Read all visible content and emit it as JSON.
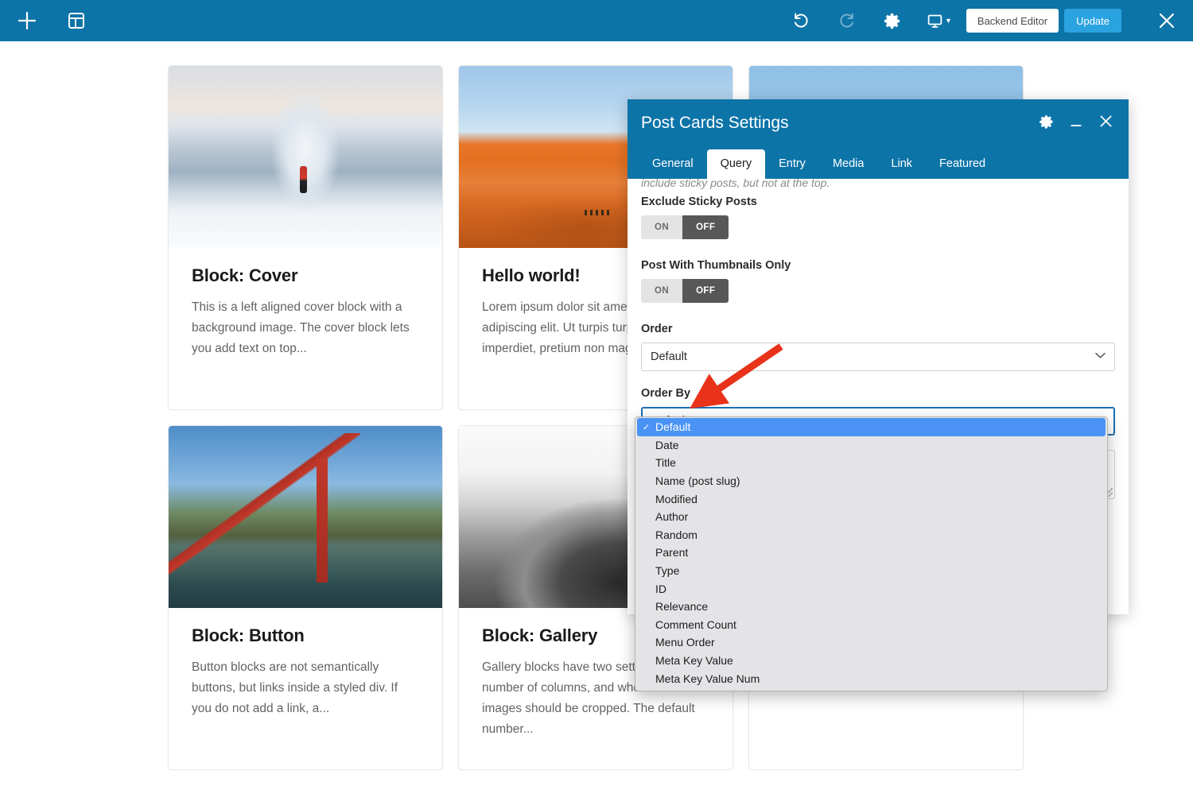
{
  "toolbar": {
    "add_icon": "plus-icon",
    "templates_icon": "layout-template-icon",
    "undo_icon": "undo-icon",
    "redo_icon": "redo-icon",
    "settings_icon": "gear-icon",
    "responsive_icon": "desktop-monitor-icon",
    "backend_editor_label": "Backend Editor",
    "update_label": "Update",
    "close_icon": "close-icon",
    "accent_color": "#0d74a8",
    "update_color": "#2ba3e0"
  },
  "cards": [
    {
      "title": "Block: Cover",
      "excerpt": "This is a left aligned cover block with a background image. The cover block lets you add text on top...",
      "image_name": "matterhorn-snow-photo",
      "image_class": "ph-matterhorn"
    },
    {
      "title": "Hello world!",
      "excerpt": "Lorem ipsum dolor sit amet, consectetur adipiscing elit. Ut turpis turpis, viverra at imperdiet, pretium non magna. Sed n",
      "image_name": "desert-dune-caravan-photo",
      "image_class": "ph-dune"
    },
    {
      "title": "",
      "excerpt": "",
      "image_name": "camel-portrait-photo",
      "image_class": "ph-camel"
    },
    {
      "title": "Block: Button",
      "excerpt": "Button blocks are not semantically buttons, but links inside a styled div.  If you do not add a link, a...",
      "image_name": "golden-gate-bridge-photo",
      "image_class": "ph-bridge"
    },
    {
      "title": "Block: Gallery",
      "excerpt": "Gallery blocks have two settings: the number of columns, and whether or not images should be cropped. The default number...",
      "image_name": "grayscale-rock-photo",
      "image_class": "ph-gallery"
    },
    {
      "title": "",
      "excerpt": "",
      "image_name": "blank-card-photo",
      "image_class": ""
    }
  ],
  "modal": {
    "title": "Post Cards Settings",
    "gear_icon": "gear-icon",
    "minimize_icon": "minimize-icon",
    "close_icon": "close-icon",
    "tabs": [
      {
        "label": "General",
        "active": false
      },
      {
        "label": "Query",
        "active": true
      },
      {
        "label": "Entry",
        "active": false
      },
      {
        "label": "Media",
        "active": false
      },
      {
        "label": "Link",
        "active": false
      },
      {
        "label": "Featured",
        "active": false
      }
    ],
    "hint_text": "include sticky posts, but not at the top.",
    "fields": {
      "exclude_sticky": {
        "label": "Exclude Sticky Posts",
        "on_label": "ON",
        "off_label": "OFF",
        "value": "OFF"
      },
      "thumbnails_only": {
        "label": "Post With Thumbnails Only",
        "on_label": "ON",
        "off_label": "OFF",
        "value": "OFF"
      },
      "order": {
        "label": "Order",
        "value": "Default",
        "chevron": "chevron-down-icon"
      },
      "order_by": {
        "label": "Order By",
        "value": "Default"
      }
    }
  },
  "dropdown": {
    "name": "order-by-dropdown",
    "selected": "Default",
    "check_glyph": "✓",
    "highlight_color": "#4a93f5",
    "options": [
      "Default",
      "Date",
      "Title",
      "Name (post slug)",
      "Modified",
      "Author",
      "Random",
      "Parent",
      "Type",
      "ID",
      "Relevance",
      "Comment Count",
      "Menu Order",
      "Meta Key Value",
      "Meta Key Value Num"
    ]
  },
  "annotation": {
    "name": "red-arrow-pointer",
    "color": "#e8321a"
  }
}
